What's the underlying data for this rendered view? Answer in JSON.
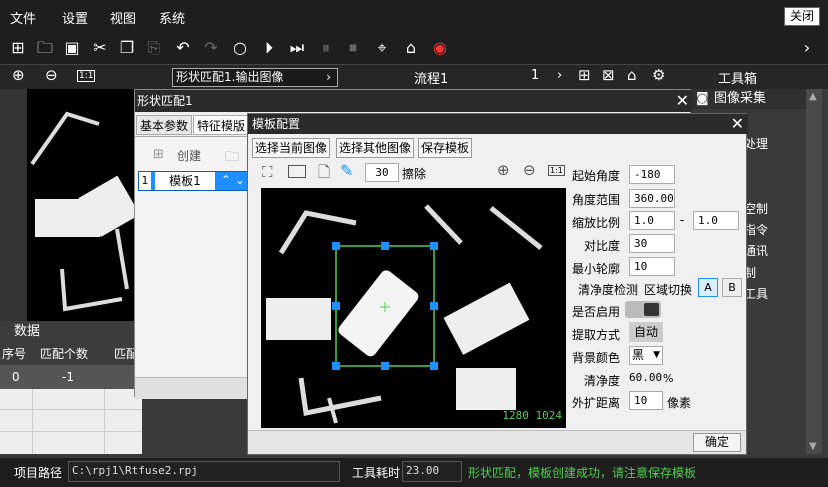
{
  "menu": [
    "文件",
    "设置",
    "视图",
    "系统"
  ],
  "close_app": "关闭",
  "row2": {
    "flow_select": "形状匹配1.输出图像",
    "process": "流程1",
    "page": "1",
    "toolbox": "工具箱"
  },
  "right_panel": {
    "title": "图像采集",
    "items": [
      "处理",
      "空制",
      "指令",
      "通讯",
      "制",
      "工具"
    ]
  },
  "data_panel": {
    "title": "数据",
    "columns": [
      "序号",
      "匹配个数",
      "匹配"
    ],
    "row": [
      "0",
      "-1"
    ]
  },
  "status": {
    "path_label": "项目路径",
    "path": "C:\\rpj1\\Rtfuse2.rpj",
    "time_label": "工具耗时",
    "time": "23.00",
    "message": "形状匹配，模板创建成功，请注意保存模板"
  },
  "dialog1": {
    "title": "形状匹配1",
    "tabs": [
      "基本参数",
      "特征模版"
    ],
    "create": "创建",
    "template_item": "模板1",
    "template_index": "1"
  },
  "dialog2": {
    "title": "模板配置",
    "buttons": [
      "选择当前图像",
      "选择其他图像",
      "保存模板"
    ],
    "brush_size": "30",
    "erase": "擦除",
    "image_size": "1280 1024",
    "confirm": "确定",
    "params": {
      "start_angle_label": "起始角度",
      "start_angle": "-180",
      "angle_range_label": "角度范围",
      "angle_range": "360.00",
      "scale_label": "缩放比例",
      "scale_min": "1.0",
      "scale_dash": "-",
      "scale_max": "1.0",
      "contrast_label": "对比度",
      "contrast": "30",
      "min_contour_label": "最小轮廓",
      "min_contour": "10",
      "clean_check_label": "清净度检测",
      "region_switch_label": "区域切换",
      "region_a": "A",
      "region_b": "B",
      "enable_label": "是否启用",
      "extract_label": "提取方式",
      "extract": "自动",
      "bg_color_label": "背景颜色",
      "bg_color": "黑",
      "cleanliness_label": "清净度",
      "cleanliness": "60.00",
      "cleanliness_unit": "%",
      "expand_label": "外扩距离",
      "expand": "10",
      "expand_unit": "像素"
    }
  },
  "colors": {
    "accent_blue": "#1e8fff",
    "status_green": "#4cd04c",
    "red": "#ff3030"
  }
}
